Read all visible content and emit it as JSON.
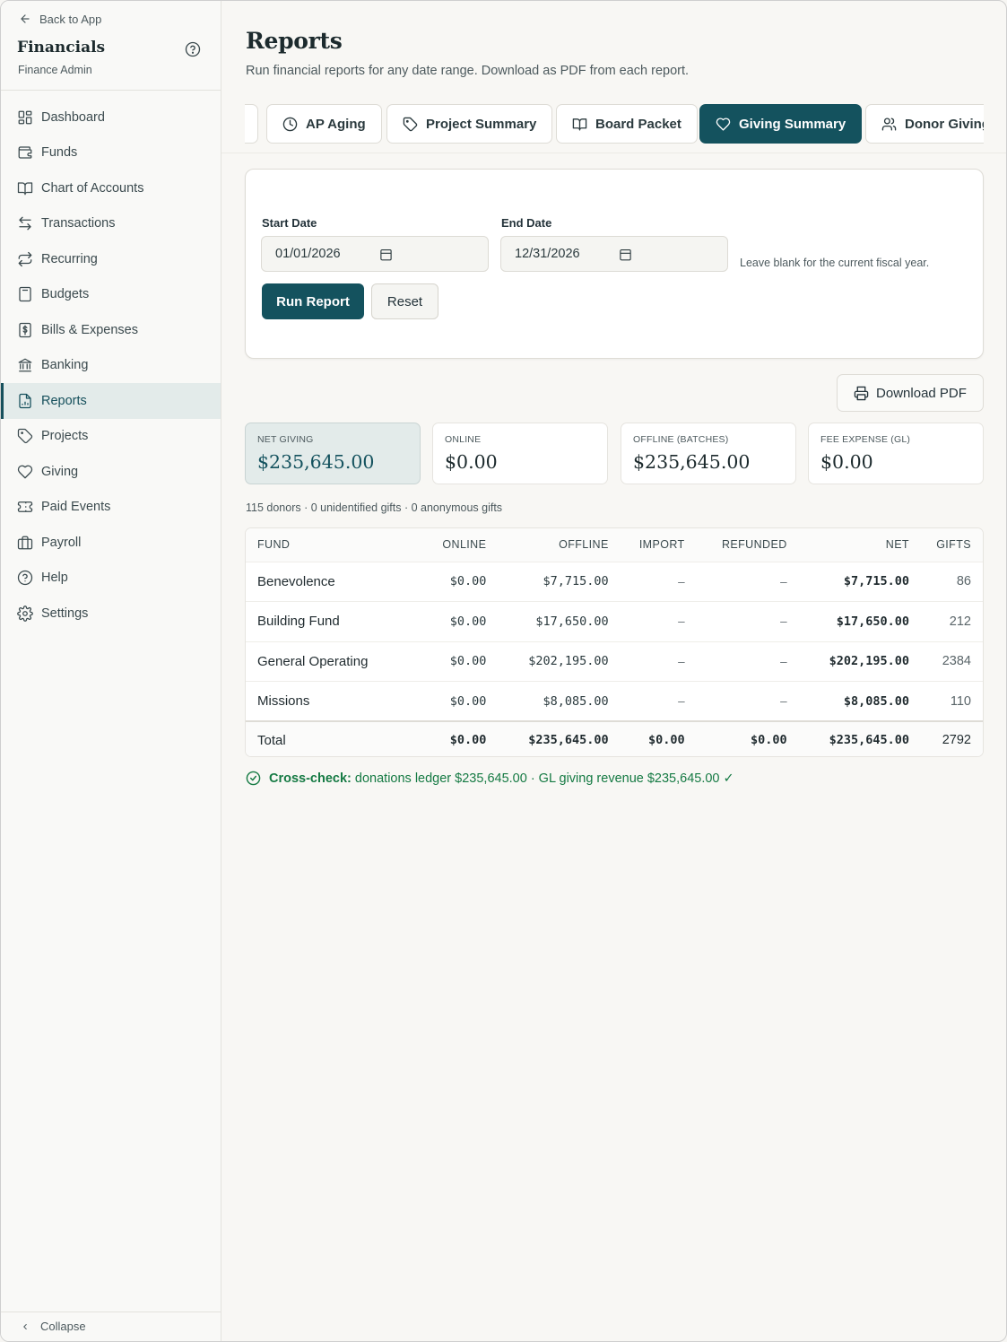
{
  "sidebar": {
    "back_label": "Back to App",
    "app_title": "Financials",
    "app_subtitle": "Finance Admin",
    "items": [
      {
        "label": "Dashboard",
        "icon": "layout-grid-icon"
      },
      {
        "label": "Funds",
        "icon": "wallet-icon"
      },
      {
        "label": "Chart of Accounts",
        "icon": "book-open-icon"
      },
      {
        "label": "Transactions",
        "icon": "arrows-left-right-icon"
      },
      {
        "label": "Recurring",
        "icon": "repeat-icon"
      },
      {
        "label": "Budgets",
        "icon": "calculator-icon"
      },
      {
        "label": "Bills & Expenses",
        "icon": "receipt-icon"
      },
      {
        "label": "Banking",
        "icon": "bank-icon"
      },
      {
        "label": "Reports",
        "icon": "file-chart-icon",
        "active": true
      },
      {
        "label": "Projects",
        "icon": "tag-icon"
      },
      {
        "label": "Giving",
        "icon": "heart-icon"
      },
      {
        "label": "Paid Events",
        "icon": "ticket-icon"
      },
      {
        "label": "Payroll",
        "icon": "briefcase-icon"
      },
      {
        "label": "Help",
        "icon": "help-circle-icon"
      },
      {
        "label": "Settings",
        "icon": "gear-icon"
      }
    ],
    "collapse_label": "Collapse"
  },
  "header": {
    "title": "Reports",
    "subtitle": "Run financial reports for any date range. Download as PDF from each report."
  },
  "tabs": [
    {
      "label": "AP Aging",
      "icon": "clock-icon"
    },
    {
      "label": "Project Summary",
      "icon": "tag-icon"
    },
    {
      "label": "Board Packet",
      "icon": "book-open-icon"
    },
    {
      "label": "Giving Summary",
      "icon": "heart-icon",
      "active": true
    },
    {
      "label": "Donor Giving",
      "icon": "users-icon"
    }
  ],
  "filters": {
    "start_label": "Start Date",
    "start_value": "01/01/2026",
    "end_label": "End Date",
    "end_value": "12/31/2026",
    "hint": "Leave blank for the current fiscal year.",
    "run_label": "Run Report",
    "reset_label": "Reset"
  },
  "download_label": "Download PDF",
  "stats": [
    {
      "label": "NET GIVING",
      "value": "$235,645.00"
    },
    {
      "label": "ONLINE",
      "value": "$0.00"
    },
    {
      "label": "OFFLINE (BATCHES)",
      "value": "$235,645.00"
    },
    {
      "label": "FEE EXPENSE (GL)",
      "value": "$0.00"
    }
  ],
  "summary_line": "115 donors · 0 unidentified gifts · 0 anonymous gifts",
  "table": {
    "headers": [
      "FUND",
      "ONLINE",
      "OFFLINE",
      "IMPORT",
      "REFUNDED",
      "NET",
      "GIFTS"
    ],
    "rows": [
      [
        "Benevolence",
        "$0.00",
        "$7,715.00",
        "–",
        "–",
        "$7,715.00",
        "86"
      ],
      [
        "Building Fund",
        "$0.00",
        "$17,650.00",
        "–",
        "–",
        "$17,650.00",
        "212"
      ],
      [
        "General Operating",
        "$0.00",
        "$202,195.00",
        "–",
        "–",
        "$202,195.00",
        "2384"
      ],
      [
        "Missions",
        "$0.00",
        "$8,085.00",
        "–",
        "–",
        "$8,085.00",
        "110"
      ]
    ],
    "total": [
      "Total",
      "$0.00",
      "$235,645.00",
      "$0.00",
      "$0.00",
      "$235,645.00",
      "2792"
    ]
  },
  "crosscheck": {
    "label": "Cross-check:",
    "text": "donations ledger $235,645.00 · GL giving revenue $235,645.00 ✓"
  },
  "colors": {
    "accent": "#14525e",
    "success": "#157a43"
  }
}
